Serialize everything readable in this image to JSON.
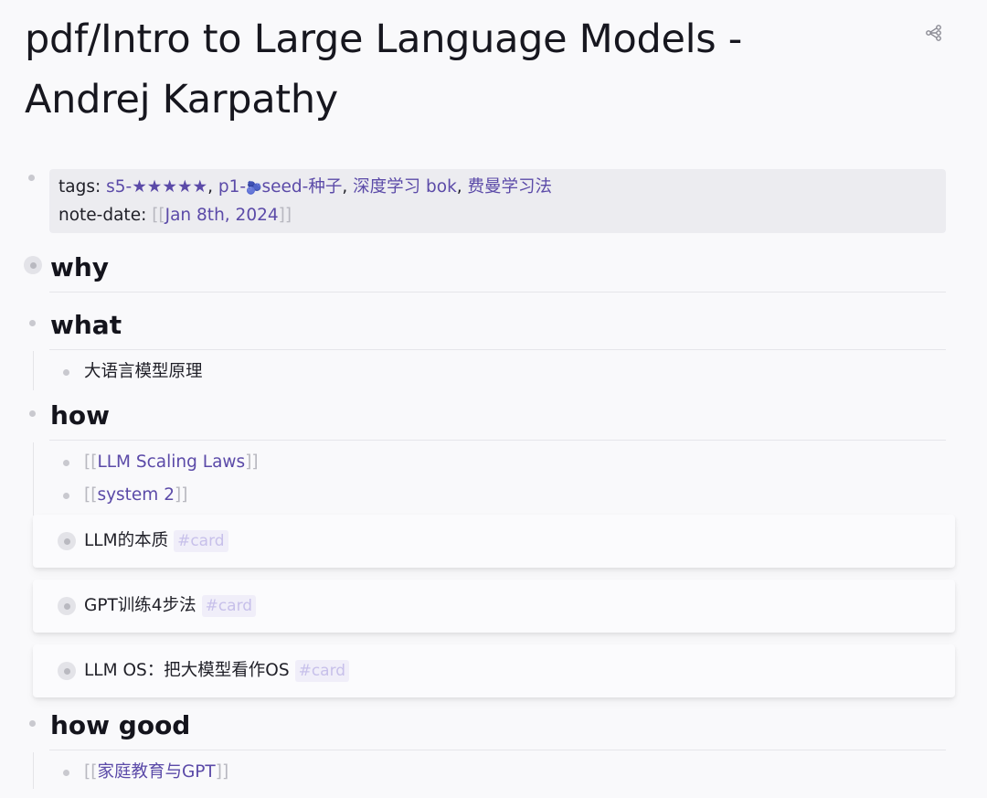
{
  "page": {
    "title": "pdf/Intro to Large Language Models - Andrej Karpathy"
  },
  "properties": {
    "tags_key": "tags:",
    "tags": [
      "s5-★★★★★",
      "p1-",
      "seed-种子",
      "深度学习 bok",
      "费曼学习法"
    ],
    "seed_icon": "🫐",
    "note_date_key": "note-date:",
    "note_date": "Jan 8th, 2024"
  },
  "bracket_open": "[[",
  "bracket_close": "]]",
  "comma": ", ",
  "sections": {
    "why": {
      "heading": "why"
    },
    "what": {
      "heading": "what",
      "items": [
        "大语言模型原理"
      ]
    },
    "how": {
      "heading": "how",
      "links": [
        "LLM Scaling Laws",
        "system 2"
      ],
      "cards": [
        {
          "text": "LLM的本质",
          "tag": "#card"
        },
        {
          "text": "GPT训练4步法",
          "tag": "#card"
        },
        {
          "text": "LLM OS：把大模型看作OS",
          "tag": "#card"
        }
      ]
    },
    "how_good": {
      "heading": "how good",
      "links": [
        "家庭教育与GPT"
      ]
    }
  }
}
